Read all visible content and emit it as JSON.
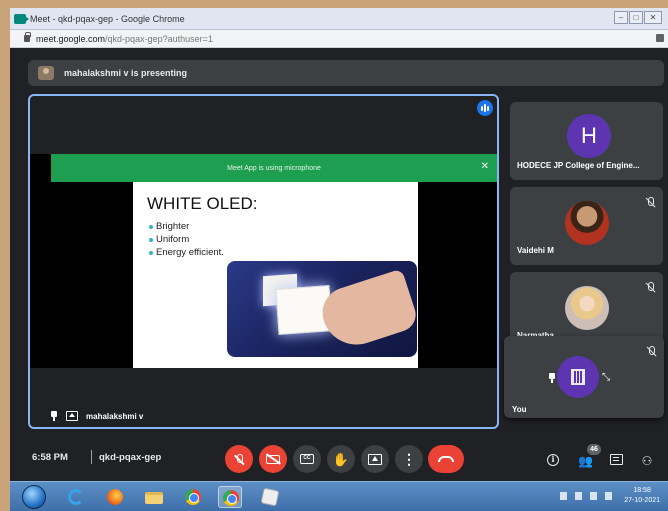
{
  "browser": {
    "window_title": "Meet - qkd-pqax-gep - Google Chrome",
    "url_host": "meet.google.com",
    "url_path": "/qkd-pqax-gep?authuser=1"
  },
  "banner": {
    "text": "mahalakshmi v is presenting"
  },
  "stage": {
    "mic_notice": "Meet App is using microphone",
    "mic_close": "✕",
    "slide_title": "WHITE OLED:",
    "bullets": [
      "Brighter",
      "Uniform",
      "Energy efficient."
    ],
    "presenter_name": "mahalakshmi v"
  },
  "participants": [
    {
      "name": "HODECE JP College of Engine...",
      "avatar_letter": "H",
      "avatar_color": "#5e35b1",
      "muted": false
    },
    {
      "name": "Vaidehi M",
      "muted": true
    },
    {
      "name": "Narmatha",
      "muted": true
    }
  ],
  "self_view": {
    "name": "You",
    "muted": true,
    "shrink": "⤡"
  },
  "bottom_bar": {
    "time": "6:58 PM",
    "meeting_code": "qkd-pqax-gep",
    "people_count": "46",
    "info_glyph": "i",
    "activities_glyph": "⚇",
    "hand_glyph": "✋",
    "dots_glyph": "⋮"
  },
  "taskbar": {
    "clock_time": "18:58",
    "clock_date": "27-10-2021"
  },
  "colors": {
    "accent": "#8ab4f8",
    "end_call": "#ea4335",
    "avatar_purple": "#5e35b1",
    "meet_green": "#1e9e50"
  }
}
